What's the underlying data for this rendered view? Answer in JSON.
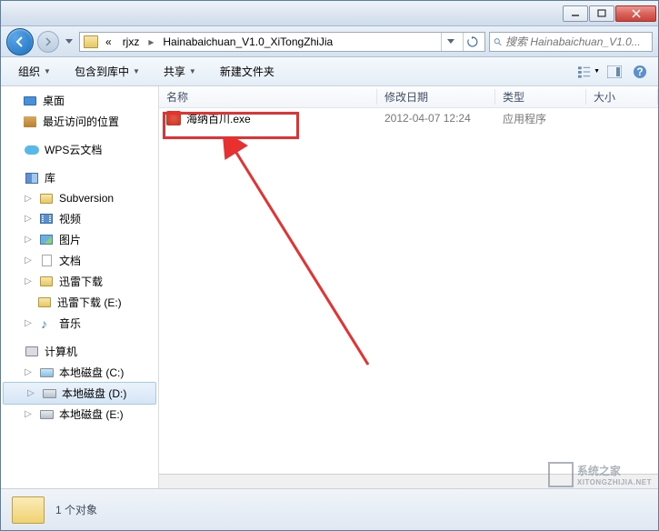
{
  "titlebar": {},
  "navbar": {
    "crumb_parent": "rjxz",
    "crumb_current": "Hainabaichuan_V1.0_XiTongZhiJia",
    "search_placeholder": "搜索 Hainabaichuan_V1.0..."
  },
  "toolbar": {
    "organize": "组织",
    "include": "包含到库中",
    "share": "共享",
    "newfolder": "新建文件夹"
  },
  "columns": {
    "name": "名称",
    "date": "修改日期",
    "type": "类型",
    "size": "大小"
  },
  "sidebar": {
    "desktop": "桌面",
    "recent": "最近访问的位置",
    "wps": "WPS云文档",
    "library": "库",
    "subversion": "Subversion",
    "video": "视频",
    "pictures": "图片",
    "documents": "文档",
    "xunlei": "迅雷下载",
    "xunlei_e": "迅雷下载 (E:)",
    "music": "音乐",
    "computer": "计算机",
    "disk_c": "本地磁盘 (C:)",
    "disk_d": "本地磁盘 (D:)",
    "disk_e": "本地磁盘 (E:)"
  },
  "files": [
    {
      "name": "海纳百川.exe",
      "date": "2012-04-07 12:24",
      "type": "应用程序"
    }
  ],
  "statusbar": {
    "count": "1 个对象"
  },
  "watermark": {
    "text": "系统之家",
    "url": "XITONGZHIJIA.NET"
  }
}
